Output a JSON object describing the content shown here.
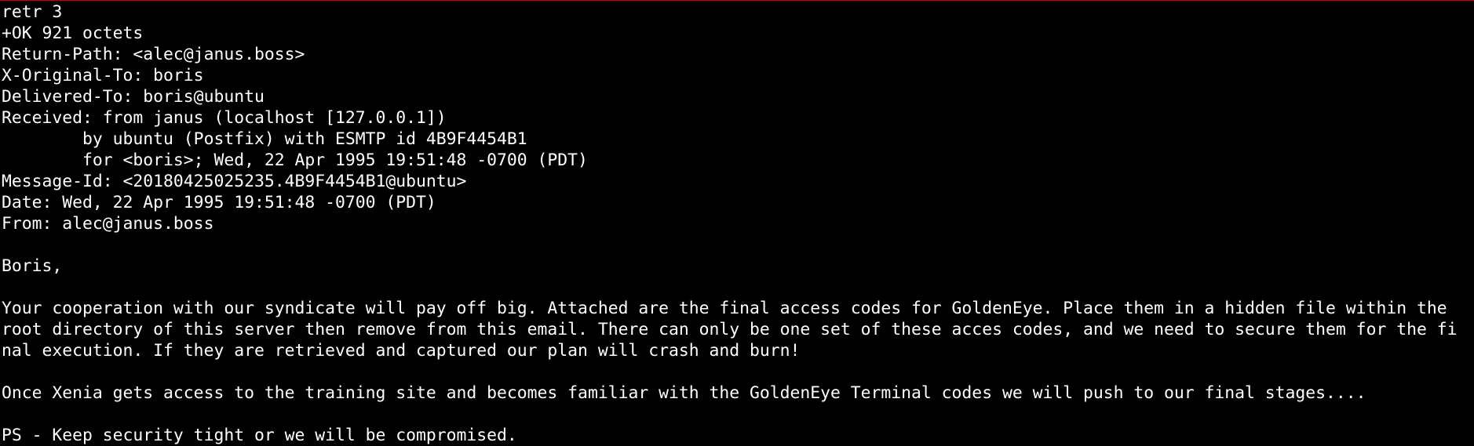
{
  "terminal": {
    "lines": [
      "retr 3",
      "+OK 921 octets",
      "Return-Path: <alec@janus.boss>",
      "X-Original-To: boris",
      "Delivered-To: boris@ubuntu",
      "Received: from janus (localhost [127.0.0.1])",
      "        by ubuntu (Postfix) with ESMTP id 4B9F4454B1",
      "        for <boris>; Wed, 22 Apr 1995 19:51:48 -0700 (PDT)",
      "Message-Id: <20180425025235.4B9F4454B1@ubuntu>",
      "Date: Wed, 22 Apr 1995 19:51:48 -0700 (PDT)",
      "From: alec@janus.boss",
      "",
      "Boris,",
      "",
      "Your cooperation with our syndicate will pay off big. Attached are the final access codes for GoldenEye. Place them in a hidden file within the",
      "root directory of this server then remove from this email. There can only be one set of these acces codes, and we need to secure them for the fi",
      "nal execution. If they are retrieved and captured our plan will crash and burn!",
      "",
      "Once Xenia gets access to the training site and becomes familiar with the GoldenEye Terminal codes we will push to our final stages....",
      "",
      "PS - Keep security tight or we will be compromised."
    ]
  }
}
